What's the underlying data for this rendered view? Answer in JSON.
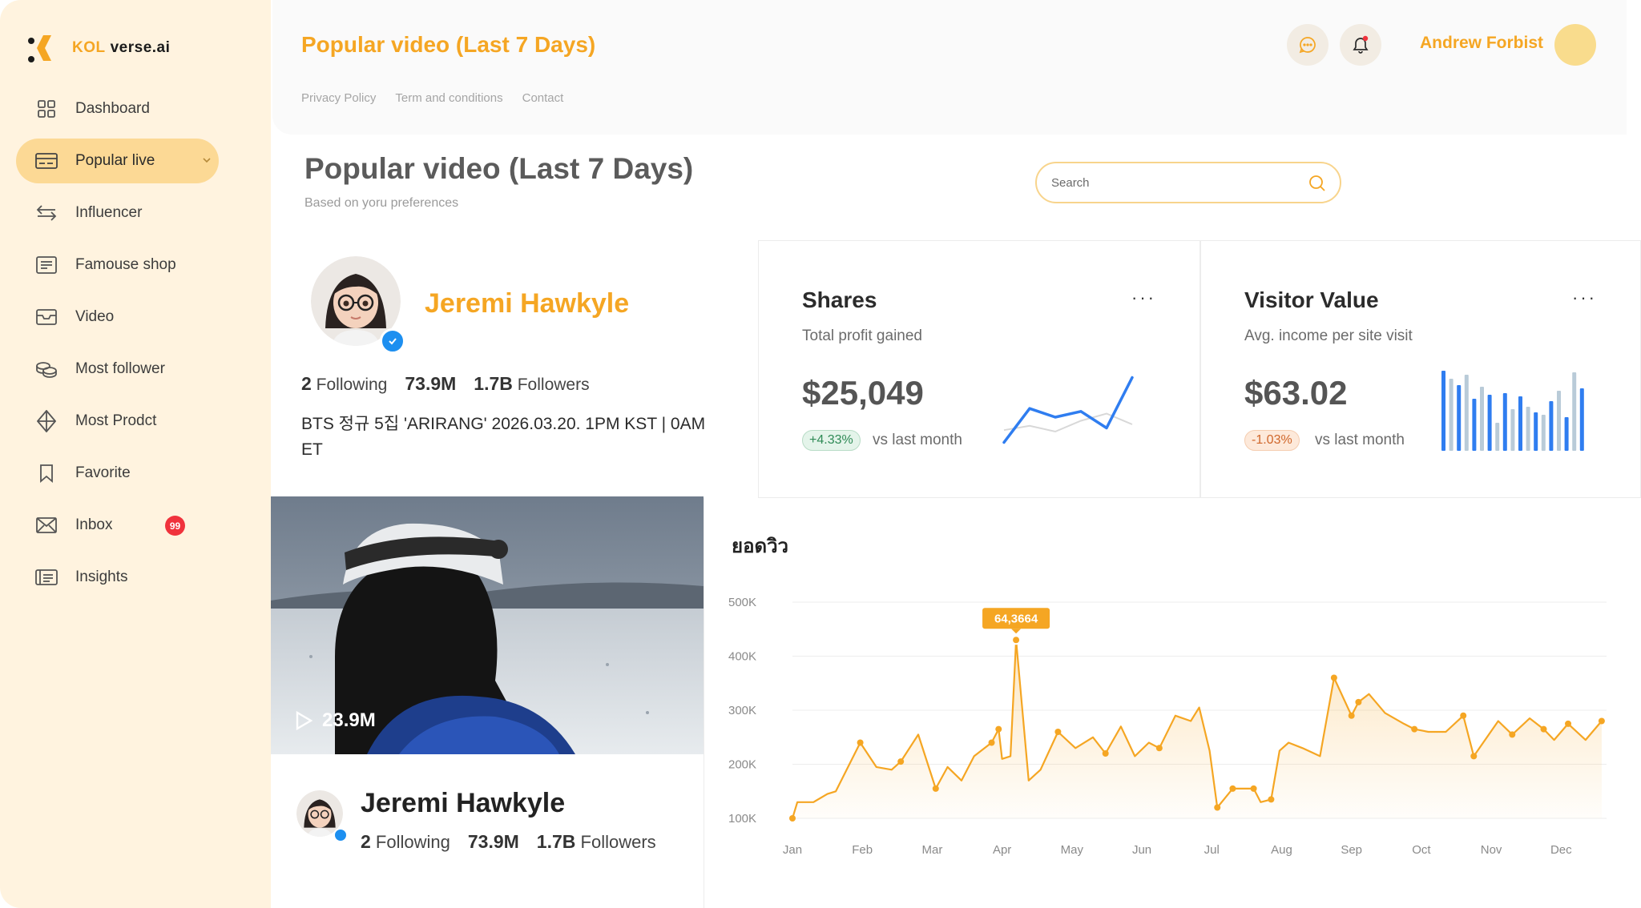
{
  "app": {
    "logo_kol": "KOL",
    "logo_rest": "verse.ai"
  },
  "sidebar": {
    "items": [
      {
        "label": "Dashboard",
        "icon": "grid-icon"
      },
      {
        "label": "Popular live",
        "icon": "card-icon"
      },
      {
        "label": "Influencer",
        "icon": "swap-icon"
      },
      {
        "label": "Famouse shop",
        "icon": "list-box-icon"
      },
      {
        "label": "Video",
        "icon": "inbox-tray-icon"
      },
      {
        "label": "Most follower",
        "icon": "coins-icon"
      },
      {
        "label": "Most Prodct",
        "icon": "diamond-icon"
      },
      {
        "label": "Favorite",
        "icon": "bookmark-icon"
      },
      {
        "label": "Inbox",
        "icon": "mail-icon",
        "badge": "99"
      },
      {
        "label": "Insights",
        "icon": "document-icon"
      }
    ]
  },
  "header": {
    "title": "Popular video (Last 7 Days)",
    "links": [
      "Privacy Policy",
      "Term and conditions",
      "Contact"
    ],
    "user_name": "Andrew Forbist"
  },
  "page": {
    "title": "Popular video (Last 7 Days)",
    "subtitle": "Based on yoru preferences",
    "search_placeholder": "Search"
  },
  "profile": {
    "name": "Jeremi Hawkyle",
    "following_count": "2",
    "following_label": "Following",
    "likes": "73.9M",
    "followers_count": "1.7B",
    "followers_label": "Followers",
    "bio": "BTS 정규 5집 'ARIRANG' 2026.03.20. 1PM KST | 0AM ET"
  },
  "cards": {
    "shares": {
      "title": "Shares",
      "subtitle": "Total profit gained",
      "value": "$25,049",
      "change": "+4.33%",
      "vs": "vs last month"
    },
    "visitor": {
      "title": "Visitor Value",
      "subtitle": "Avg. income per site visit",
      "value": "$63.02",
      "change": "-1.03%",
      "vs": "vs last month"
    }
  },
  "video": {
    "views": "23.9M",
    "author_name": "Jeremi Hawkyle",
    "following_count": "2",
    "following_label": "Following",
    "likes": "73.9M",
    "followers_count": "1.7B",
    "followers_label": "Followers"
  },
  "chart_data": {
    "type": "area",
    "title": "ยอดวิว",
    "categories": [
      "Jan",
      "Feb",
      "Mar",
      "Apr",
      "May",
      "Jun",
      "Jul",
      "Aug",
      "Sep",
      "Oct",
      "Nov",
      "Dec"
    ],
    "y_ticks": [
      "100K",
      "200K",
      "300K",
      "400K",
      "500K"
    ],
    "ylim": [
      100000,
      500000
    ],
    "grid": true,
    "color": "#f5a623",
    "highlight": {
      "label": "64,3664",
      "x": 3.2,
      "y": 430000
    },
    "series": [
      {
        "x": [
          0,
          0.07,
          0.3,
          0.5,
          0.62,
          0.97,
          1.2,
          1.42,
          1.55,
          1.8,
          2.05,
          2.22,
          2.42,
          2.6,
          2.85,
          2.95,
          3.0,
          3.12,
          3.2,
          3.38,
          3.55,
          3.8,
          4.05,
          4.3,
          4.48,
          4.7,
          4.9,
          5.1,
          5.25,
          5.48,
          5.7,
          5.82,
          5.97,
          6.08,
          6.3,
          6.6,
          6.7,
          6.85,
          6.97,
          7.1,
          7.3,
          7.55,
          7.75,
          8.0,
          8.1,
          8.25,
          8.48,
          8.75,
          8.9,
          9.1,
          9.35,
          9.6,
          9.75,
          10.1,
          10.3,
          10.55,
          10.75,
          10.9,
          11.1,
          11.35,
          11.58
        ],
        "y": [
          100000,
          130000,
          130000,
          145000,
          150000,
          240000,
          195000,
          190000,
          205000,
          255000,
          155000,
          195000,
          170000,
          215000,
          240000,
          265000,
          210000,
          215000,
          430000,
          170000,
          190000,
          260000,
          230000,
          250000,
          220000,
          270000,
          215000,
          240000,
          230000,
          290000,
          280000,
          305000,
          225000,
          120000,
          155000,
          155000,
          130000,
          135000,
          225000,
          240000,
          230000,
          215000,
          360000,
          290000,
          315000,
          330000,
          295000,
          275000,
          265000,
          260000,
          260000,
          290000,
          215000,
          280000,
          255000,
          285000,
          265000,
          245000,
          275000,
          245000,
          280000
        ]
      }
    ]
  },
  "mini_charts": {
    "shares_line": {
      "values": [
        5,
        52,
        40,
        48,
        25,
        95
      ],
      "ghost": [
        22,
        28,
        20,
        35,
        45,
        30
      ],
      "color": "#2f7df0",
      "ghost_color": "#d8d8d8"
    },
    "visitor_bars": {
      "values": [
        100,
        90,
        82,
        95,
        65,
        80,
        70,
        35,
        72,
        52,
        68,
        55,
        48,
        45,
        62,
        75,
        42,
        98,
        78
      ],
      "colors": [
        "#2f7df0",
        "#b9cbd8"
      ]
    }
  }
}
